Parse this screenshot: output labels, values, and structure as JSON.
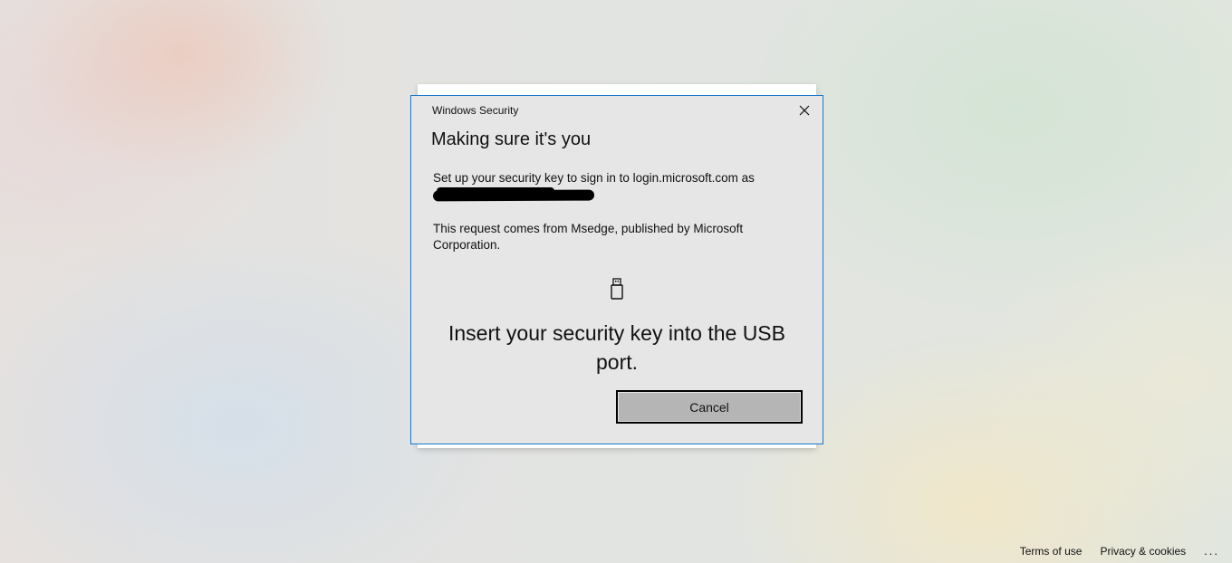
{
  "dialog": {
    "window_title": "Windows Security",
    "heading": "Making sure it's you",
    "message": "Set up your security key to sign in to login.microsoft.com as",
    "account_redacted": true,
    "source_text": "This request comes from Msedge, published by Microsoft Corporation.",
    "instruction": "Insert your security key into the USB port.",
    "cancel_label": "Cancel",
    "close_icon": "close-icon",
    "key_icon": "usb-security-key-icon",
    "border_color": "#1979ca"
  },
  "footer": {
    "terms_label": "Terms of use",
    "privacy_label": "Privacy & cookies",
    "more_label": "..."
  }
}
